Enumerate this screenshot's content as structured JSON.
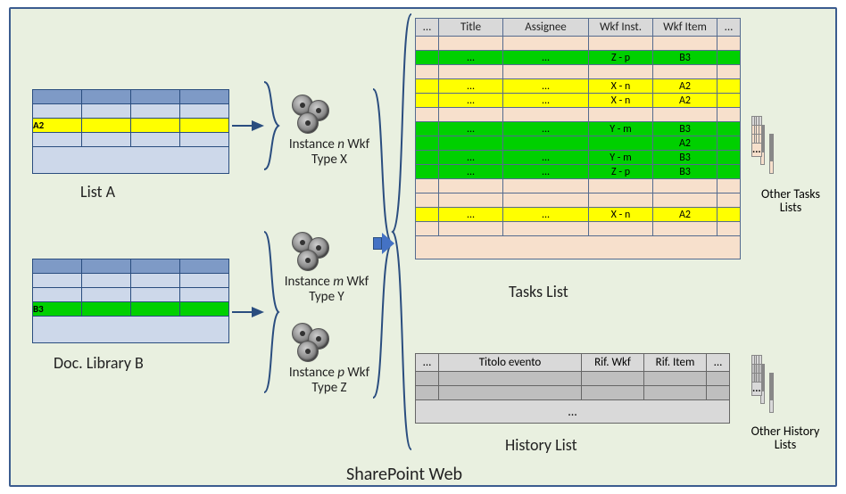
{
  "main_label": "SharePoint Web",
  "list_a": {
    "caption": "List A",
    "highlight_cell": "A2"
  },
  "list_b": {
    "caption": "Doc. Library B",
    "highlight_cell": "B3"
  },
  "instances": {
    "n": {
      "line1": "Instance n Wkf",
      "line1_html_note": "n italic",
      "line2": "Type X"
    },
    "m": {
      "line1": "Instance m Wkf",
      "line2": "Type Y"
    },
    "p": {
      "line1": "Instance p Wkf",
      "line2": "Type Z"
    }
  },
  "tasks": {
    "caption": "Tasks List",
    "columns": [
      "...",
      "Title",
      "Assignee",
      "Wkf Inst.",
      "Wkf Item",
      "..."
    ],
    "rows": [
      {
        "cls": "peach",
        "cells": [
          "",
          "",
          "",
          "",
          "",
          ""
        ]
      },
      {
        "cls": "green",
        "cells": [
          "",
          "...",
          "...",
          "Z - p",
          "B3",
          ""
        ]
      },
      {
        "cls": "peach",
        "cells": [
          "",
          "",
          "",
          "",
          "",
          ""
        ]
      },
      {
        "cls": "yellow",
        "cells": [
          "",
          "...",
          "...",
          "X - n",
          "A2",
          ""
        ]
      },
      {
        "cls": "yellow",
        "cells": [
          "",
          "...",
          "...",
          "X - n",
          "A2",
          ""
        ]
      },
      {
        "cls": "peach",
        "cells": [
          "",
          "",
          "",
          "",
          "",
          ""
        ]
      },
      {
        "cls": "green",
        "cells": [
          "",
          "...",
          "...",
          "Y - m",
          "B3",
          ""
        ]
      },
      {
        "cls": "green",
        "cells": [
          "",
          "",
          "",
          "",
          "A2",
          ""
        ]
      },
      {
        "cls": "green",
        "cells": [
          "",
          "...",
          "...",
          "Y - m",
          "B3",
          ""
        ]
      },
      {
        "cls": "green",
        "cells": [
          "",
          "...",
          "...",
          "Z - p",
          "B3",
          ""
        ]
      },
      {
        "cls": "peach",
        "cells": [
          "",
          "",
          "",
          "",
          "",
          ""
        ]
      },
      {
        "cls": "peach",
        "cells": [
          "",
          "",
          "",
          "",
          "",
          ""
        ]
      },
      {
        "cls": "yellow",
        "cells": [
          "",
          "...",
          "...",
          "X - n",
          "A2",
          ""
        ]
      },
      {
        "cls": "peach",
        "cells": [
          "",
          "",
          "",
          "",
          "",
          ""
        ]
      }
    ]
  },
  "history": {
    "caption": "History List",
    "columns": [
      "...",
      "Titolo evento",
      "Rif. Wkf",
      "Rif. Item",
      "..."
    ],
    "ellipsis": "..."
  },
  "other_tasks_caption": "Other Tasks\nLists",
  "other_history_caption": "Other History\nLists",
  "ellipsis": "..."
}
